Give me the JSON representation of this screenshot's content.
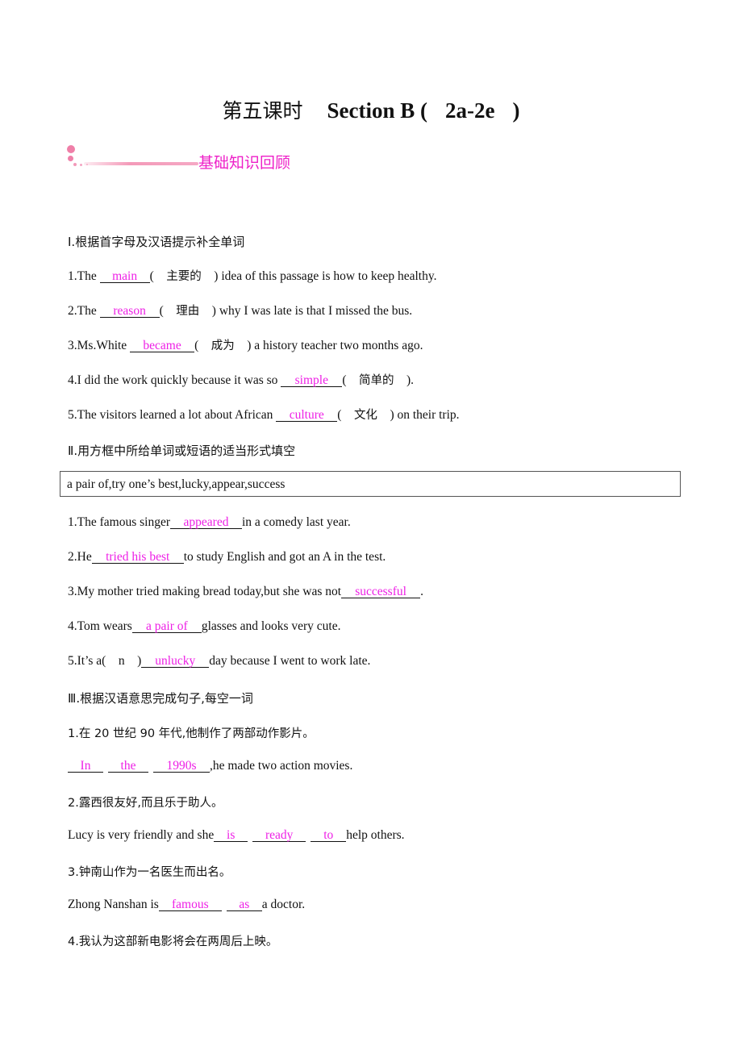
{
  "title": {
    "cn": "第五课时",
    "section": "Section B (",
    "range": "2a-2e",
    "close": ")"
  },
  "banner": {
    "label": "基础知识回顾",
    "accent_color": "#ee20c8"
  },
  "part1": {
    "heading": "Ⅰ.根据首字母及汉语提示补全单词",
    "items": [
      {
        "prefix": "1.The ",
        "answer": "main",
        "hint": "主要的",
        "suffix": ") idea of this passage is how to keep healthy."
      },
      {
        "prefix": "2.The ",
        "answer": "reason",
        "hint": "理由",
        "suffix": ") why I was late is that I missed the bus."
      },
      {
        "prefix": "3.Ms.White ",
        "answer": "became",
        "hint": "成为",
        "suffix": ") a history teacher two months ago."
      },
      {
        "prefix": "4.I did the work quickly because it was so ",
        "answer": "simple",
        "hint": "简单的",
        "suffix": ")."
      },
      {
        "prefix": "5.The visitors learned a lot about African ",
        "answer": "culture",
        "hint": "文化",
        "suffix": ") on their trip."
      }
    ]
  },
  "part2": {
    "heading": "Ⅱ.用方框中所给单词或短语的适当形式填空",
    "word_box": "a pair of,try one’s best,lucky,appear,success",
    "items": [
      {
        "prefix": "1.The famous singer",
        "answer": "appeared",
        "suffix": "in a comedy last year."
      },
      {
        "prefix": "2.He",
        "answer": "tried his best",
        "suffix": "to study English and got an A in the test."
      },
      {
        "prefix": "3.My mother tried making bread today,but she was not",
        "answer": "successful",
        "suffix": "."
      },
      {
        "prefix": "4.Tom wears",
        "answer": "a pair of",
        "suffix": "glasses and looks very cute."
      },
      {
        "prefix": "5.It’s a(    n    )",
        "answer": "unlucky",
        "suffix": "day because I went to work late."
      }
    ]
  },
  "part3": {
    "heading": "Ⅲ.根据汉语意思完成句子,每空一词",
    "items": [
      {
        "cn": "1.在 20 世纪 90 年代,他制作了两部动作影片。",
        "prefix": "",
        "answers": [
          "In",
          "the",
          "1990s"
        ],
        "suffix": ",he made two action movies."
      },
      {
        "cn": "2.露西很友好,而且乐于助人。",
        "prefix": "Lucy is very friendly and she",
        "answers": [
          "is",
          "ready",
          "to"
        ],
        "suffix": "help others."
      },
      {
        "cn": "3.钟南山作为一名医生而出名。",
        "prefix": "Zhong Nanshan is",
        "answers": [
          "famous",
          "as"
        ],
        "suffix": "a doctor."
      },
      {
        "cn": "4.我认为这部新电影将会在两周后上映。"
      }
    ]
  }
}
